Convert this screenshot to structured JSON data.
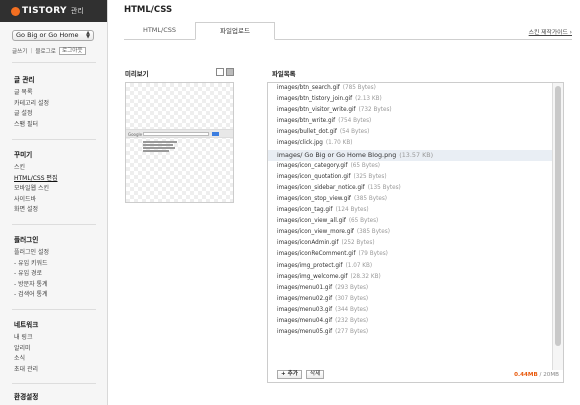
{
  "brand": {
    "name": "TISTORY",
    "sub": "관리"
  },
  "blog_select": {
    "value": "Go Big or Go Home"
  },
  "quicklinks": {
    "write": "글쓰기",
    "blog": "블로그로",
    "logout": "로그아웃"
  },
  "menu": {
    "post": {
      "title": "글 관리",
      "items": [
        "글 목록",
        "카테고리 설정",
        "글 설정",
        "스팸 필터"
      ]
    },
    "design": {
      "title": "꾸미기",
      "items": [
        "스킨",
        "HTML/CSS 편집",
        "모바일웹 스킨",
        "사이드바",
        "화면 설정"
      ]
    },
    "plugin": {
      "title": "플러그인",
      "items": [
        "플러그인 설정",
        "- 유입 키워드",
        "- 유입 경로",
        "- 방문자 통계",
        "- 검색어 통계"
      ]
    },
    "network": {
      "title": "네트워크",
      "items": [
        "내 링크",
        "알리미",
        "소식",
        "초대 관리"
      ]
    },
    "env": {
      "title": "환경설정"
    }
  },
  "page_title": "HTML/CSS",
  "tabs": {
    "html": "HTML/CSS",
    "upload": "파일업로드",
    "guide": "스킨 제작가이드 ›"
  },
  "preview": {
    "label": "미리보기",
    "logo": "Google"
  },
  "file_panel": {
    "label": "파일목록",
    "files": [
      {
        "name": "images/btn_search.gif",
        "size": "(785 Bytes)"
      },
      {
        "name": "images/btn_tistory_join.gif",
        "size": "(2.13 KB)"
      },
      {
        "name": "images/btn_visitor_write.gif",
        "size": "(732 Bytes)"
      },
      {
        "name": "images/btn_write.gif",
        "size": "(754 Bytes)"
      },
      {
        "name": "images/bullet_dot.gif",
        "size": "(54 Bytes)"
      },
      {
        "name": "images/click.jpg",
        "size": "(1.70 KB)"
      },
      {
        "name": "images/ Go Big or Go Home Blog.png",
        "size": "(13.57 KB)"
      },
      {
        "name": "images/icon_category.gif",
        "size": "(65 Bytes)"
      },
      {
        "name": "images/icon_quotation.gif",
        "size": "(325 Bytes)"
      },
      {
        "name": "images/icon_sidebar_notice.gif",
        "size": "(135 Bytes)"
      },
      {
        "name": "images/icon_stop_view.gif",
        "size": "(385 Bytes)"
      },
      {
        "name": "images/icon_tag.gif",
        "size": "(124 Bytes)"
      },
      {
        "name": "images/icon_view_all.gif",
        "size": "(65 Bytes)"
      },
      {
        "name": "images/icon_view_more.gif",
        "size": "(385 Bytes)"
      },
      {
        "name": "images/iconAdmin.gif",
        "size": "(252 Bytes)"
      },
      {
        "name": "images/iconReComment.gif",
        "size": "(79 Bytes)"
      },
      {
        "name": "images/img_protect.gif",
        "size": "(1.07 KB)"
      },
      {
        "name": "images/img_welcome.gif",
        "size": "(28.32 KB)"
      },
      {
        "name": "images/menu01.gif",
        "size": "(293 Bytes)"
      },
      {
        "name": "images/menu02.gif",
        "size": "(307 Bytes)"
      },
      {
        "name": "images/menu03.gif",
        "size": "(344 Bytes)"
      },
      {
        "name": "images/menu04.gif",
        "size": "(232 Bytes)"
      },
      {
        "name": "images/menu05.gif",
        "size": "(277 Bytes)"
      }
    ],
    "selected_index": 6,
    "add_label": "+ 추가",
    "delete_label": "삭제",
    "usage_used": "0.44MB",
    "usage_total": "/ 20MB"
  },
  "colors": {
    "accent": "#f36f21",
    "usage": "#e8590c",
    "selected_row": "#e9eef4"
  },
  "icons": {
    "select_arrow": "chevron-updown-icon",
    "logo": "tistory-logo-icon"
  }
}
